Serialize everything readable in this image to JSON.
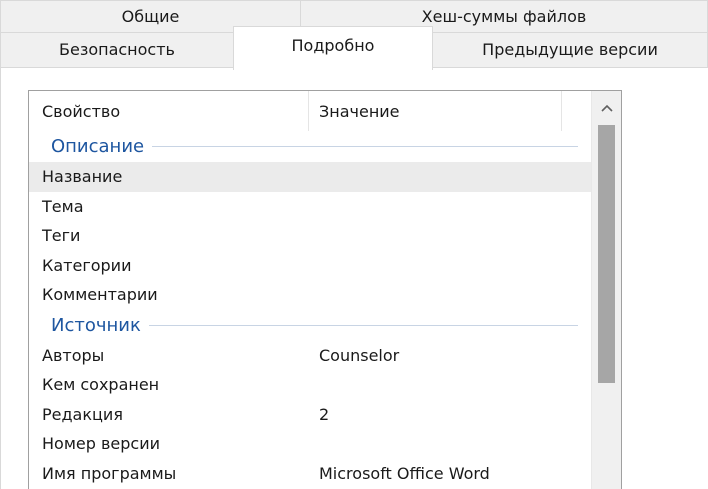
{
  "tabs": {
    "row1": [
      {
        "label": "Общие"
      },
      {
        "label": "Хеш-суммы файлов"
      }
    ],
    "row2": [
      {
        "label": "Безопасность"
      },
      {
        "label": "Подробно",
        "active": true
      },
      {
        "label": "Предыдущие версии"
      }
    ]
  },
  "table": {
    "columns": [
      "Свойство",
      "Значение"
    ],
    "groups": [
      {
        "title": "Описание",
        "rows": [
          {
            "property": "Название",
            "value": "",
            "selected": true
          },
          {
            "property": "Тема",
            "value": ""
          },
          {
            "property": "Теги",
            "value": ""
          },
          {
            "property": "Категории",
            "value": ""
          },
          {
            "property": "Комментарии",
            "value": ""
          }
        ]
      },
      {
        "title": "Источник",
        "rows": [
          {
            "property": "Авторы",
            "value": "Counselor"
          },
          {
            "property": "Кем сохранен",
            "value": ""
          },
          {
            "property": "Редакция",
            "value": "2"
          },
          {
            "property": "Номер версии",
            "value": ""
          },
          {
            "property": "Имя программы",
            "value": "Microsoft Office Word"
          }
        ]
      }
    ]
  },
  "icons": {
    "scroll_up": "chevron-up-icon"
  },
  "colors": {
    "group_title": "#1e56a0",
    "selected_row": "#ebebeb",
    "scroll_thumb": "#a6a6a6"
  }
}
